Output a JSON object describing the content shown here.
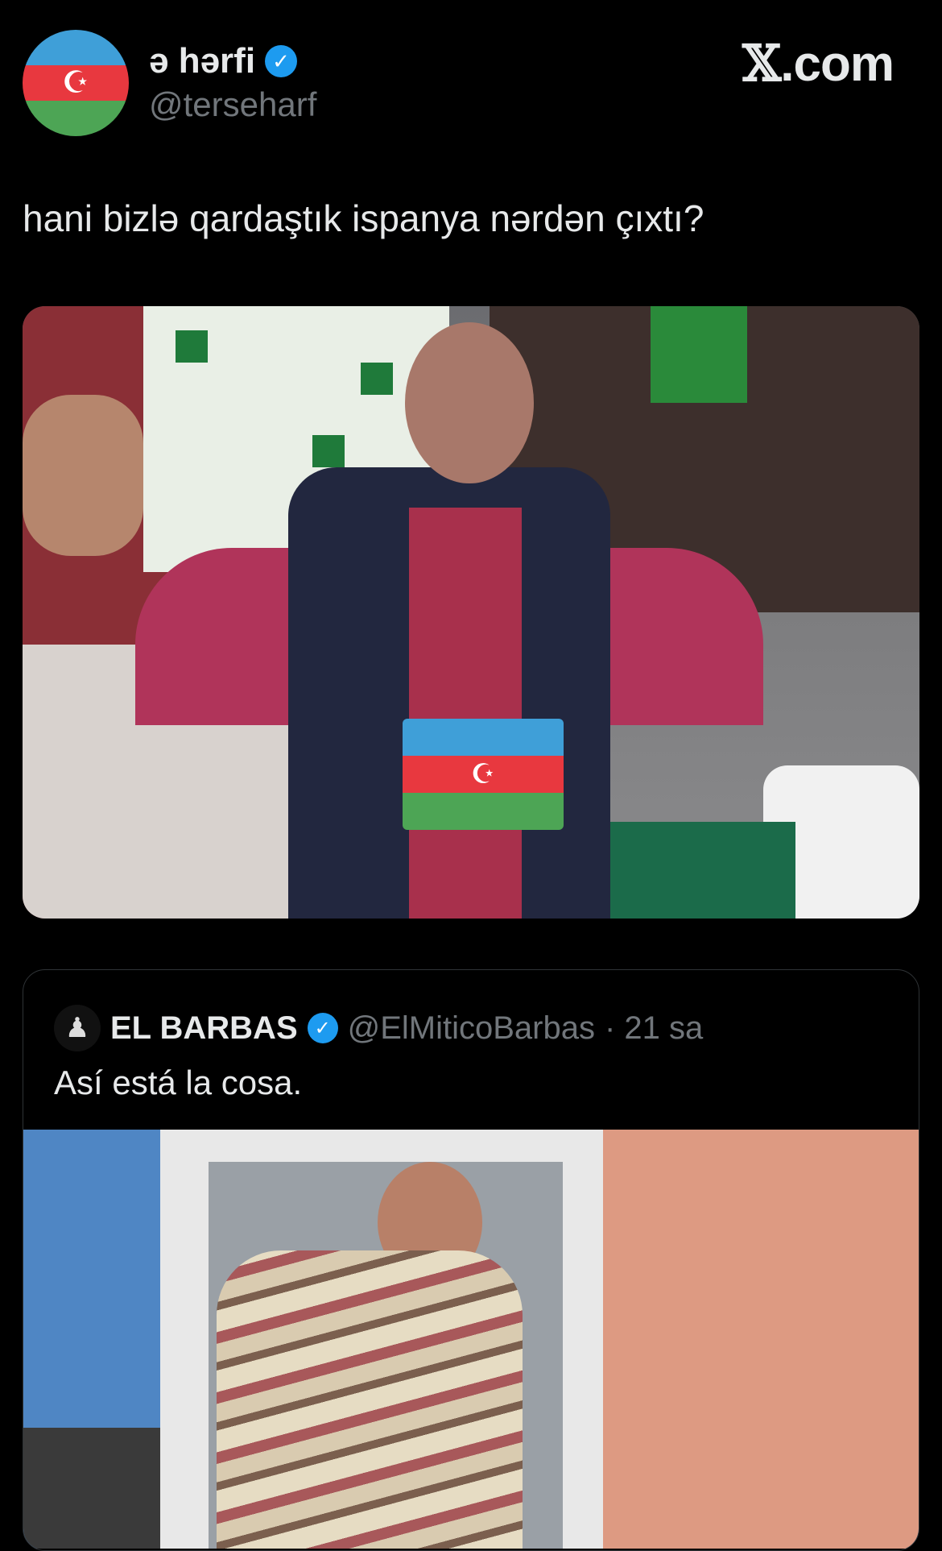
{
  "author": {
    "display_name": "ə hərfi",
    "handle": "@terseharf",
    "verified_icon": "verified-badge-icon",
    "avatar": "azerbaijan-flag-avatar"
  },
  "brand": {
    "label_x": "𝕏",
    "label_suffix": ".com"
  },
  "tweet": {
    "text": "hani bizlə qardaştık ispanya nərdən çıxtı?",
    "media": "photo-disappointed-cricket-fan-with-azerbaijan-flag-emoji"
  },
  "quoted": {
    "display_name": "EL BARBAS",
    "handle": "@ElMiticoBarbas",
    "time": "· 21 sa",
    "text": "Así está la cosa.",
    "media": "photo-man-in-striped-shirt"
  },
  "colors": {
    "background": "#000000",
    "text": "#e7e9ea",
    "muted": "#71767b",
    "verified": "#1d9bf0",
    "flag_blue": "#3f9fd8",
    "flag_red": "#e8383f",
    "flag_green": "#4da555"
  }
}
